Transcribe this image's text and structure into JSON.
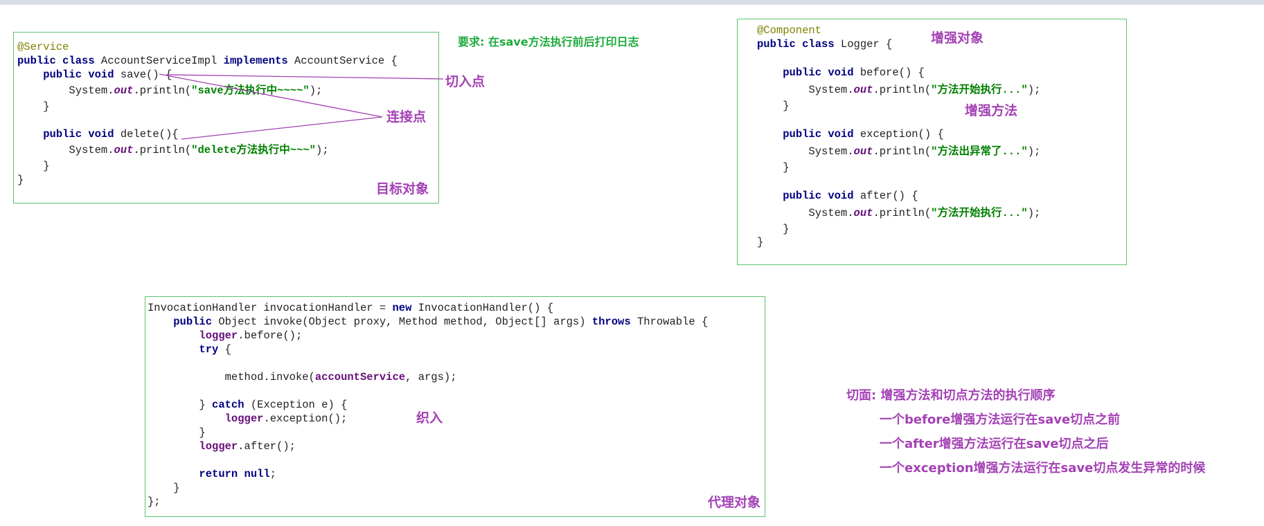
{
  "target": {
    "annotation": "@Service",
    "l1_kw": "public class",
    "l1_name": " AccountServiceImpl ",
    "l1_impl": "implements",
    "l1_tail": " AccountService {",
    "l2_kw": "public void",
    "l2_tail": " save() {",
    "l3_a": "System.",
    "l3_out": "out",
    "l3_b": ".println(",
    "l3_str": "\"save方法执行中~~~~\"",
    "l3_c": ");",
    "l4": "}",
    "l6_kw": "public void",
    "l6_tail": " delete(){",
    "l7_a": "System.",
    "l7_out": "out",
    "l7_b": ".println(",
    "l7_str": "\"delete方法执行中~~~\"",
    "l7_c": ");",
    "l8": "}",
    "l9": "}"
  },
  "logger": {
    "annotation": "@Component",
    "l1_kw": "public class",
    "l1_tail": " Logger {",
    "m1_kw": "public void",
    "m1_tail": " before() {",
    "m1_a": "System.",
    "m1_out": "out",
    "m1_b": ".println(",
    "m1_str": "\"方法开始执行...\"",
    "m1_c": ");",
    "m1_close": "}",
    "m2_kw": "public void",
    "m2_tail": " exception() {",
    "m2_a": "System.",
    "m2_out": "out",
    "m2_b": ".println(",
    "m2_str": "\"方法出异常了...\"",
    "m2_c": ");",
    "m2_close": "}",
    "m3_kw": "public void",
    "m3_tail": " after() {",
    "m3_a": "System.",
    "m3_out": "out",
    "m3_b": ".println(",
    "m3_str": "\"方法开始执行...\"",
    "m3_c": ");",
    "m3_close": "}",
    "close": "}"
  },
  "proxy": {
    "p1_a": "InvocationHandler invocationHandler = ",
    "p1_new": "new",
    "p1_b": " InvocationHandler() {",
    "p2_kw": "public",
    "p2_a": " Object invoke(Object proxy, Method method, Object[] args) ",
    "p2_throws": "throws",
    "p2_b": " Throwable {",
    "p3_logger": "logger",
    "p3_b": ".before();",
    "p4_try": "try",
    "p4_b": " {",
    "p6_a": "method.invoke(",
    "p6_svc": "accountService",
    "p6_b": ", args);",
    "p8_a": "} ",
    "p8_catch": "catch",
    "p8_b": " (Exception e) {",
    "p9_logger": "logger",
    "p9_b": ".exception();",
    "p10": "}",
    "p11_logger": "logger",
    "p11_b": ".after();",
    "p13_return": "return",
    "p13_null": "null",
    "p13_b": ";",
    "p14": "}",
    "p15": "};"
  },
  "labels": {
    "requirement": "要求: 在save方法执行前后打印日志",
    "pointcut": "切入点",
    "joinpoint": "连接点",
    "target_object": "目标对象",
    "enhancement_object": "增强对象",
    "enhancement_method": "增强方法",
    "weaving": "织入",
    "proxy_object": "代理对象"
  },
  "aspect": {
    "title": "切面: 增强方法和切点方法的执行顺序",
    "line1": "一个before增强方法运行在save切点之前",
    "line2": "一个after增强方法运行在save切点之后",
    "line3": "一个exception增强方法运行在save切点发生异常的时候"
  },
  "colors": {
    "box_border": "#5cc26e",
    "label_purple": "#a441b5",
    "requirement_green": "#1eaa3c",
    "keyword_navy": "#000080",
    "string_green": "#008000",
    "annotation_olive": "#808000",
    "field_purple": "#660e7a"
  }
}
